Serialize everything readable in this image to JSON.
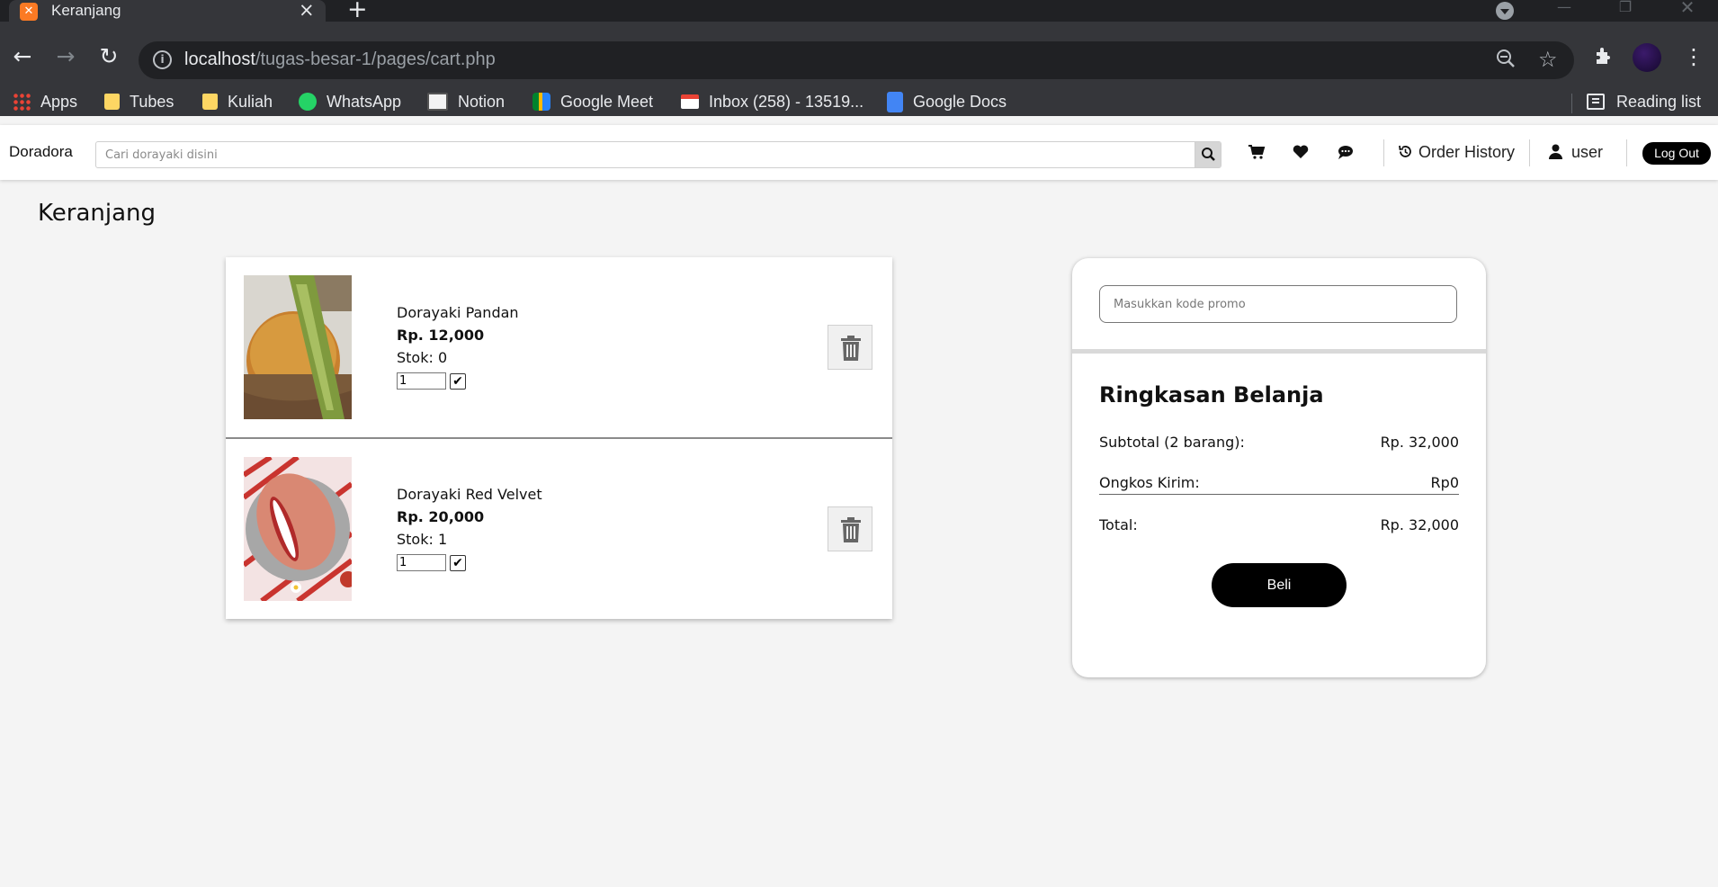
{
  "browser": {
    "tab_title": "Keranjang",
    "url_host": "localhost",
    "url_path": "/tugas-besar-1/pages/cart.php",
    "bookmarks": [
      {
        "label": "Apps",
        "icon": "apps-grid-icon"
      },
      {
        "label": "Tubes",
        "icon": "folder-icon"
      },
      {
        "label": "Kuliah",
        "icon": "folder-icon"
      },
      {
        "label": "WhatsApp",
        "icon": "whatsapp-icon"
      },
      {
        "label": "Notion",
        "icon": "notion-icon"
      },
      {
        "label": "Google Meet",
        "icon": "google-meet-icon"
      },
      {
        "label": "Inbox (258) - 13519...",
        "icon": "gmail-icon"
      },
      {
        "label": "Google Docs",
        "icon": "google-docs-icon"
      }
    ],
    "reading_list": "Reading list"
  },
  "header": {
    "brand": "Doradora",
    "search_placeholder": "Cari dorayaki disini",
    "order_history": "Order History",
    "user": "user",
    "logout": "Log Out"
  },
  "page": {
    "title": "Keranjang"
  },
  "cart": {
    "items": [
      {
        "name": "Dorayaki Pandan",
        "price": "Rp. 12,000",
        "stock": "Stok: 0",
        "qty": "1",
        "checked": true
      },
      {
        "name": "Dorayaki Red Velvet",
        "price": "Rp. 20,000",
        "stock": "Stok: 1",
        "qty": "1",
        "checked": true
      }
    ]
  },
  "summary": {
    "promo_placeholder": "Masukkan kode promo",
    "title": "Ringkasan Belanja",
    "subtotal_label": "Subtotal (2 barang):",
    "subtotal_value": "Rp. 32,000",
    "shipping_label": "Ongkos Kirim:",
    "shipping_value": "Rp0",
    "total_label": "Total:",
    "total_value": "Rp. 32,000",
    "buy_button": "Beli"
  },
  "colors": {
    "chrome_dark": "#202124",
    "chrome_toolbar": "#35363a",
    "page_bg": "#f4f4f4",
    "button_black": "#000000"
  }
}
